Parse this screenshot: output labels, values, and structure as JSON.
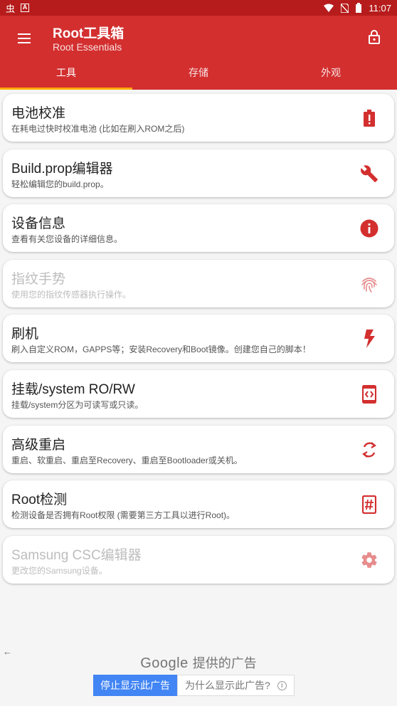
{
  "status_bar": {
    "carrier_glyph": "虫",
    "notif_glyph": "A",
    "time": "11:07"
  },
  "header": {
    "title": "Root工具箱",
    "subtitle": "Root Essentials"
  },
  "tabs": [
    {
      "label": "工具",
      "active": true
    },
    {
      "label": "存储",
      "active": false
    },
    {
      "label": "外观",
      "active": false
    }
  ],
  "items": [
    {
      "title": "电池校准",
      "desc": "在耗电过快时校准电池 (比如在刷入ROM之后)",
      "icon": "battery-alert-icon",
      "enabled": true
    },
    {
      "title": "Build.prop编辑器",
      "desc": "轻松编辑您的build.prop。",
      "icon": "wrench-icon",
      "enabled": true
    },
    {
      "title": "设备信息",
      "desc": "查看有关您设备的详细信息。",
      "icon": "info-icon",
      "enabled": true
    },
    {
      "title": "指纹手势",
      "desc": "使用您的指纹传感器执行操作。",
      "icon": "fingerprint-icon",
      "enabled": false
    },
    {
      "title": "刷机",
      "desc": "刷入自定义ROM，GAPPS等；安装Recovery和Boot镜像。创建您自己的脚本！",
      "icon": "flash-icon",
      "enabled": true
    },
    {
      "title": "挂载/system RO/RW",
      "desc": "挂载/system分区为可读写或只读。",
      "icon": "phone-code-icon",
      "enabled": true
    },
    {
      "title": "高级重启",
      "desc": "重启、软重启、重启至Recovery、重启至Bootloader或关机。",
      "icon": "reboot-icon",
      "enabled": true
    },
    {
      "title": "Root检测",
      "desc": "检测设备是否拥有Root权限 (需要第三方工具以进行Root)。",
      "icon": "root-check-icon",
      "enabled": true
    },
    {
      "title": "Samsung CSC编辑器",
      "desc": "更改您的Samsung设备。",
      "icon": "gear-icon",
      "enabled": false
    }
  ],
  "ad": {
    "brand": "Google",
    "text": "提供的广告",
    "stop_label": "停止显示此广告",
    "why_label": "为什么显示此广告?",
    "back_glyph": "←"
  },
  "colors": {
    "primary": "#d32f2f",
    "primary_dark": "#b71c1c",
    "accent": "#ffab00",
    "icon_red": "#d32f2f"
  }
}
